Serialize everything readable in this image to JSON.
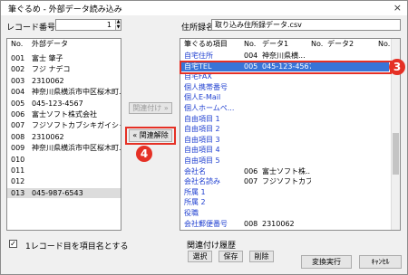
{
  "window": {
    "title": "筆ぐるめ - 外部データ読み込み",
    "close_glyph": "×"
  },
  "left": {
    "record_label": "レコード番号",
    "record_value": "1",
    "spin_up": "▲",
    "spin_down": "▼",
    "col_no": "No.",
    "col_data": "外部データ",
    "rows": [
      {
        "no": "001",
        "val": "富士 肇子"
      },
      {
        "no": "002",
        "val": "フジ ナデコ"
      },
      {
        "no": "003",
        "val": "2310062"
      },
      {
        "no": "004",
        "val": "神奈川県横浜市中区桜木町..."
      },
      {
        "no": "005",
        "val": "045-123-4567"
      },
      {
        "no": "006",
        "val": "富士ソフト株式会社"
      },
      {
        "no": "007",
        "val": "フジソフトカブシキガイシャ"
      },
      {
        "no": "008",
        "val": "2310062"
      },
      {
        "no": "009",
        "val": "神奈川県横浜市中区桜木町..."
      },
      {
        "no": "010",
        "val": ""
      },
      {
        "no": "011",
        "val": ""
      },
      {
        "no": "012",
        "val": ""
      },
      {
        "no": "013",
        "val": "045-987-6543"
      }
    ],
    "checkbox_mark": "✓",
    "checkbox_label": "1レコード目を項目名とする"
  },
  "middle": {
    "link_button": "関連付け »",
    "unlink_button": "« 関連解除"
  },
  "right": {
    "file_label": "住所録名",
    "file_value": "取り込み住所録データ.csv",
    "col_item": "筆ぐるめ項目",
    "col_no1": "No.",
    "col_data1": "データ1",
    "col_no2": "No.",
    "col_data2": "データ2",
    "col_no3": "No.",
    "rows": [
      {
        "item": "自宅住所",
        "no": "004",
        "data": "神奈川県横..."
      },
      {
        "item": "自宅TEL",
        "no": "005",
        "data": "045-123-4567"
      },
      {
        "item": "自宅FAX",
        "no": "",
        "data": ""
      },
      {
        "item": "個人携帯番号",
        "no": "",
        "data": ""
      },
      {
        "item": "個人E-Mail",
        "no": "",
        "data": ""
      },
      {
        "item": "個人ホームペ...",
        "no": "",
        "data": ""
      },
      {
        "item": "自由項目 1",
        "no": "",
        "data": ""
      },
      {
        "item": "自由項目 2",
        "no": "",
        "data": ""
      },
      {
        "item": "自由項目 3",
        "no": "",
        "data": ""
      },
      {
        "item": "自由項目 4",
        "no": "",
        "data": ""
      },
      {
        "item": "自由項目 5",
        "no": "",
        "data": ""
      },
      {
        "item": "会社名",
        "no": "006",
        "data": "富士ソフト株..."
      },
      {
        "item": "会社名読み",
        "no": "007",
        "data": "フジソフトカブシ..."
      },
      {
        "item": "所属 1",
        "no": "",
        "data": ""
      },
      {
        "item": "所属 2",
        "no": "",
        "data": ""
      },
      {
        "item": "役職",
        "no": "",
        "data": ""
      },
      {
        "item": "会社郵便番号",
        "no": "008",
        "data": "2310062"
      }
    ]
  },
  "bottom": {
    "group_label": "関連付け履歴",
    "select_button": "選択",
    "save_button": "保存",
    "delete_button": "削除",
    "exec_button": "変換実行",
    "cancel_button": "ｷｬﾝｾﾙ"
  },
  "callouts": {
    "three": "3",
    "four": "4"
  },
  "colors": {
    "accent": "#e53025",
    "selection": "#3874d8",
    "item_text": "#1f3fd0"
  }
}
